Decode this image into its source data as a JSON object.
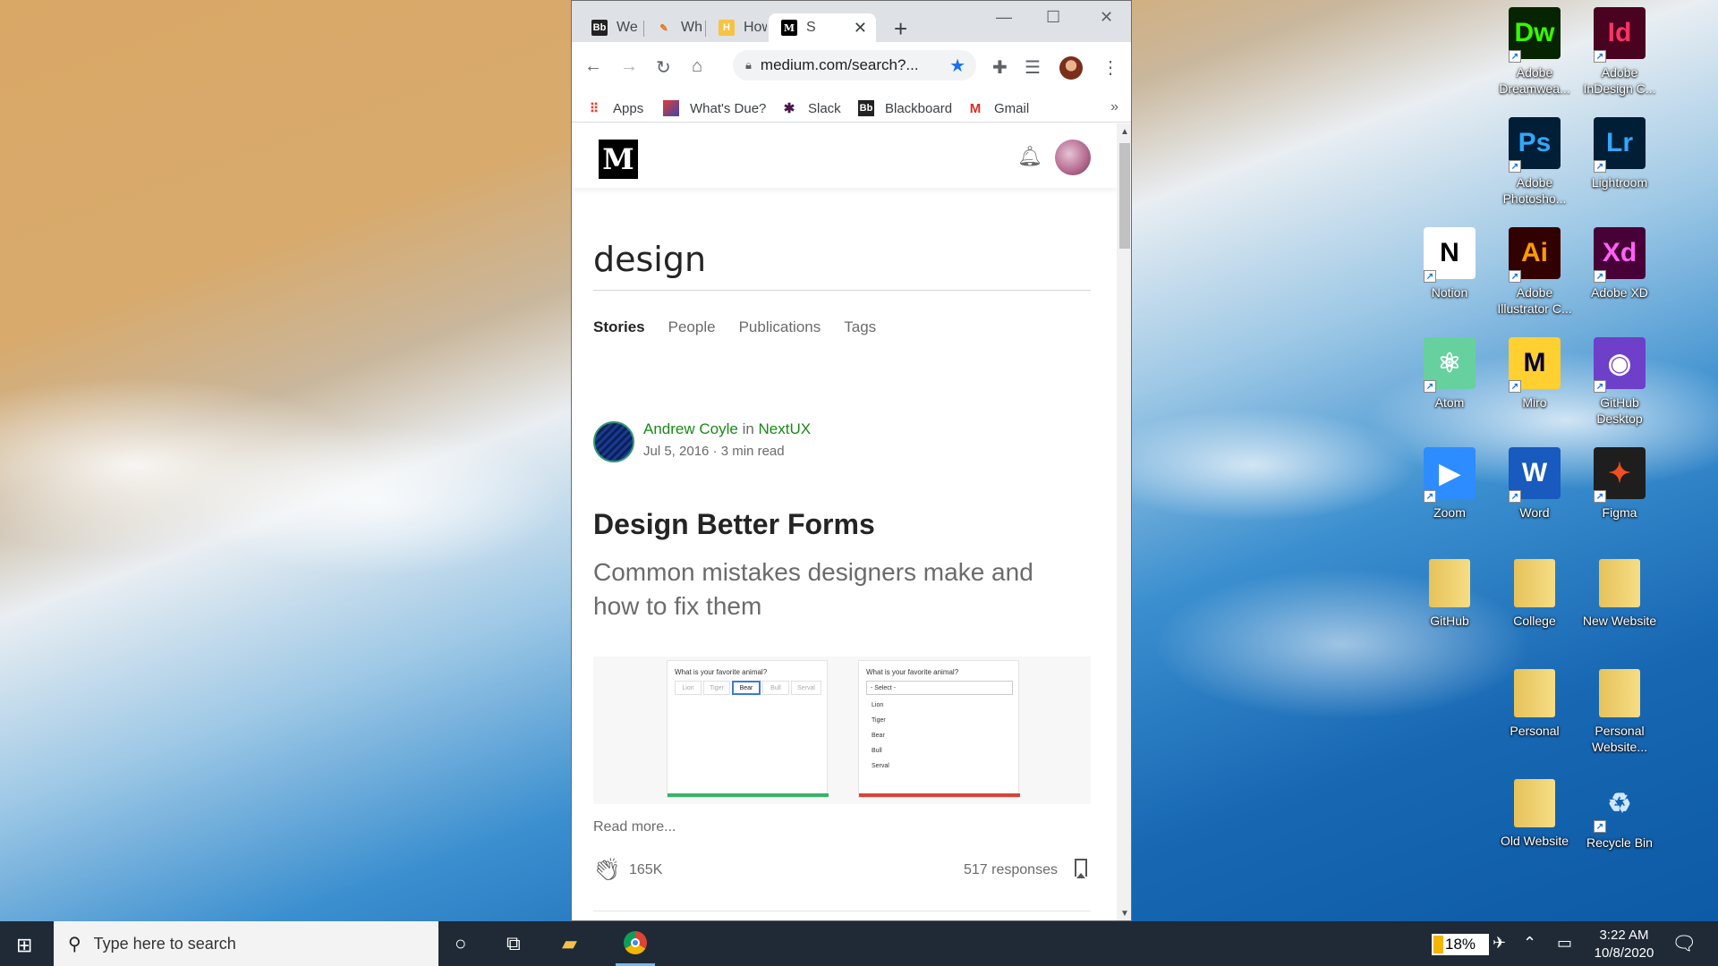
{
  "browser": {
    "tabs": [
      {
        "favicon": "Bb",
        "label": "Weel"
      },
      {
        "favicon": "pen-icon",
        "label": "What"
      },
      {
        "favicon": "H",
        "label": "How"
      },
      {
        "favicon": "M",
        "label": "S"
      }
    ],
    "url": "medium.com/search?...",
    "bookmarks": [
      "Apps",
      "What's Due?",
      "Slack",
      "Blackboard",
      "Gmail"
    ],
    "bookmarks_more": "»"
  },
  "page": {
    "search_query": "design",
    "tabs": [
      "Stories",
      "People",
      "Publications",
      "Tags"
    ],
    "active_tab": "Stories",
    "story": {
      "author": "Andrew Coyle",
      "in_text": "in",
      "publication": "NextUX",
      "date": "Jul 5, 2016",
      "separator": "·",
      "read_time": "3 min read",
      "title": "Design Better Forms",
      "subtitle": "Common mistakes designers make and how to fix them",
      "read_more": "Read more...",
      "claps": "165K",
      "responses": "517 responses"
    },
    "image": {
      "question": "What is your favorite animal?",
      "segments": [
        "Lion",
        "Tiger",
        "Bear",
        "Bull",
        "Serval"
      ],
      "selected_segment": "Bear",
      "select_placeholder": "- Select -",
      "options": [
        "Lion",
        "Tiger",
        "Bear",
        "Bull",
        "Serval"
      ]
    }
  },
  "desktop_icons": [
    {
      "label": "Adobe Dreamwea...",
      "tile": "Dw",
      "bg": "#072401",
      "fg": "#35fa00"
    },
    {
      "label": "Adobe InDesign C...",
      "tile": "Id",
      "bg": "#49021f",
      "fg": "#ff3366"
    },
    {
      "label": "Adobe Photosho...",
      "tile": "Ps",
      "bg": "#001e36",
      "fg": "#31a8ff"
    },
    {
      "label": "Lightroom",
      "tile": "Lr",
      "bg": "#001e36",
      "fg": "#31a8ff"
    },
    {
      "label": "Notion",
      "tile": "N",
      "bg": "#ffffff",
      "fg": "#000000"
    },
    {
      "label": "Adobe Illustrator C...",
      "tile": "Ai",
      "bg": "#330000",
      "fg": "#ff9a00"
    },
    {
      "label": "Adobe XD",
      "tile": "Xd",
      "bg": "#470137",
      "fg": "#ff61f6"
    },
    {
      "label": "Atom",
      "tile": "⚛",
      "bg": "#66d19e",
      "fg": "#ffffff"
    },
    {
      "label": "Miro",
      "tile": "M",
      "bg": "#ffd02f",
      "fg": "#050038"
    },
    {
      "label": "GitHub Desktop",
      "tile": "◉",
      "bg": "#6e40c9",
      "fg": "#ffffff"
    },
    {
      "label": "Zoom",
      "tile": "▶",
      "bg": "#2d8cff",
      "fg": "#ffffff"
    },
    {
      "label": "Word",
      "tile": "W",
      "bg": "#185abd",
      "fg": "#ffffff"
    },
    {
      "label": "Figma",
      "tile": "✦",
      "bg": "#1e1e1e",
      "fg": "#f24e1e"
    },
    {
      "label": "GitHub",
      "tile": "folder",
      "bg": "",
      "fg": ""
    },
    {
      "label": "College",
      "tile": "folder",
      "bg": "",
      "fg": ""
    },
    {
      "label": "New Website",
      "tile": "folder",
      "bg": "",
      "fg": ""
    },
    {
      "label": "Personal",
      "tile": "folder",
      "bg": "",
      "fg": ""
    },
    {
      "label": "Personal Website...",
      "tile": "folder",
      "bg": "",
      "fg": ""
    },
    {
      "label": "Old Website",
      "tile": "folder",
      "bg": "",
      "fg": ""
    },
    {
      "label": "Recycle Bin",
      "tile": "♻",
      "bg": "transparent",
      "fg": "#cfe8ff"
    }
  ],
  "taskbar": {
    "search_placeholder": "Type here to search",
    "battery": "18%",
    "battery_level": 0.18,
    "time": "3:22 AM",
    "date": "10/8/2020"
  }
}
